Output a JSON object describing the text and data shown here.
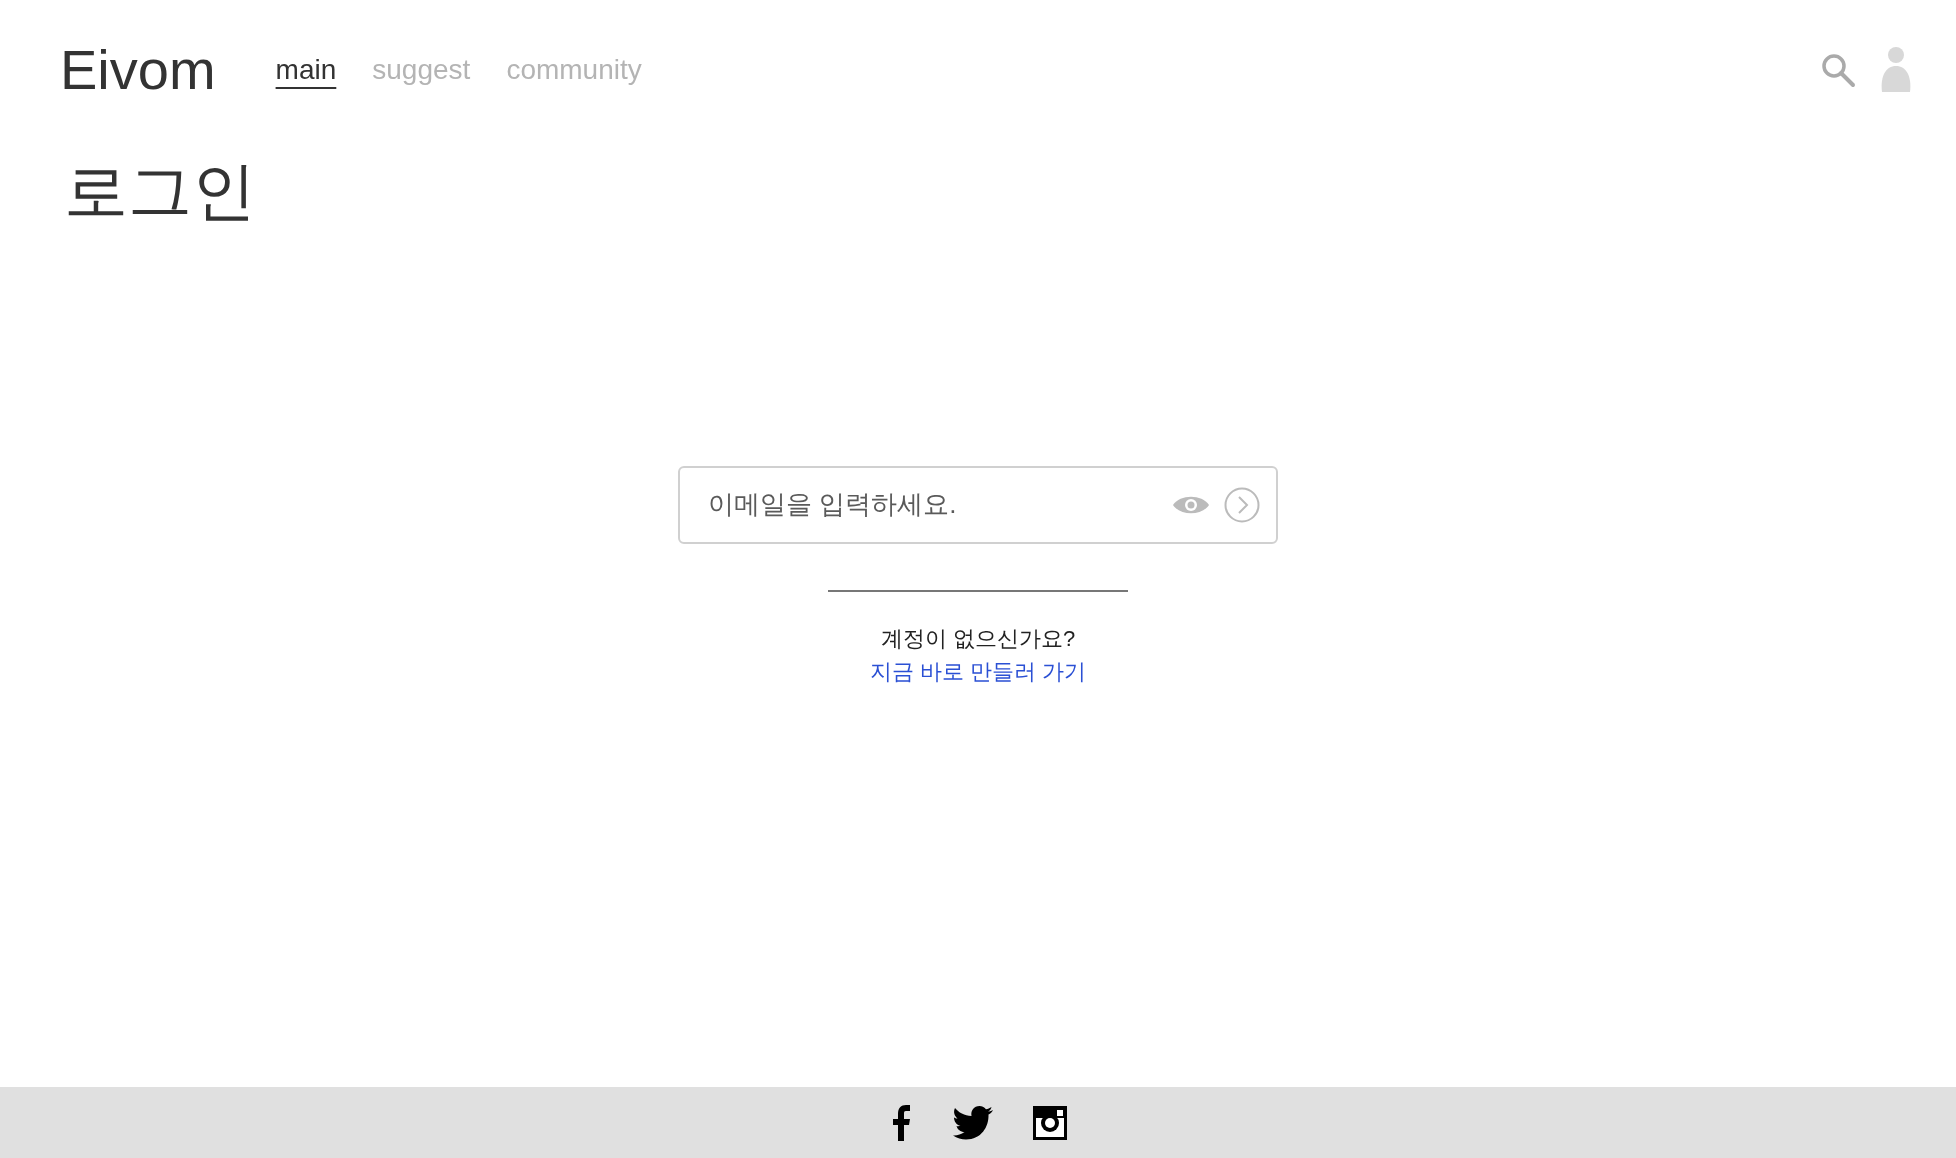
{
  "brand": "Eivom",
  "nav": [
    {
      "label": "main",
      "selected": true
    },
    {
      "label": "suggest",
      "selected": false
    },
    {
      "label": "community",
      "selected": false
    }
  ],
  "page_title": "로그인",
  "email_field": {
    "placeholder": "이메일을 입력하세요."
  },
  "signup_prompt": "계정이 없으신가요?",
  "signup_link": "지금 바로 만들러 가기",
  "social_links": [
    {
      "kind": "facebook"
    },
    {
      "kind": "twitter"
    },
    {
      "kind": "instagram"
    }
  ]
}
